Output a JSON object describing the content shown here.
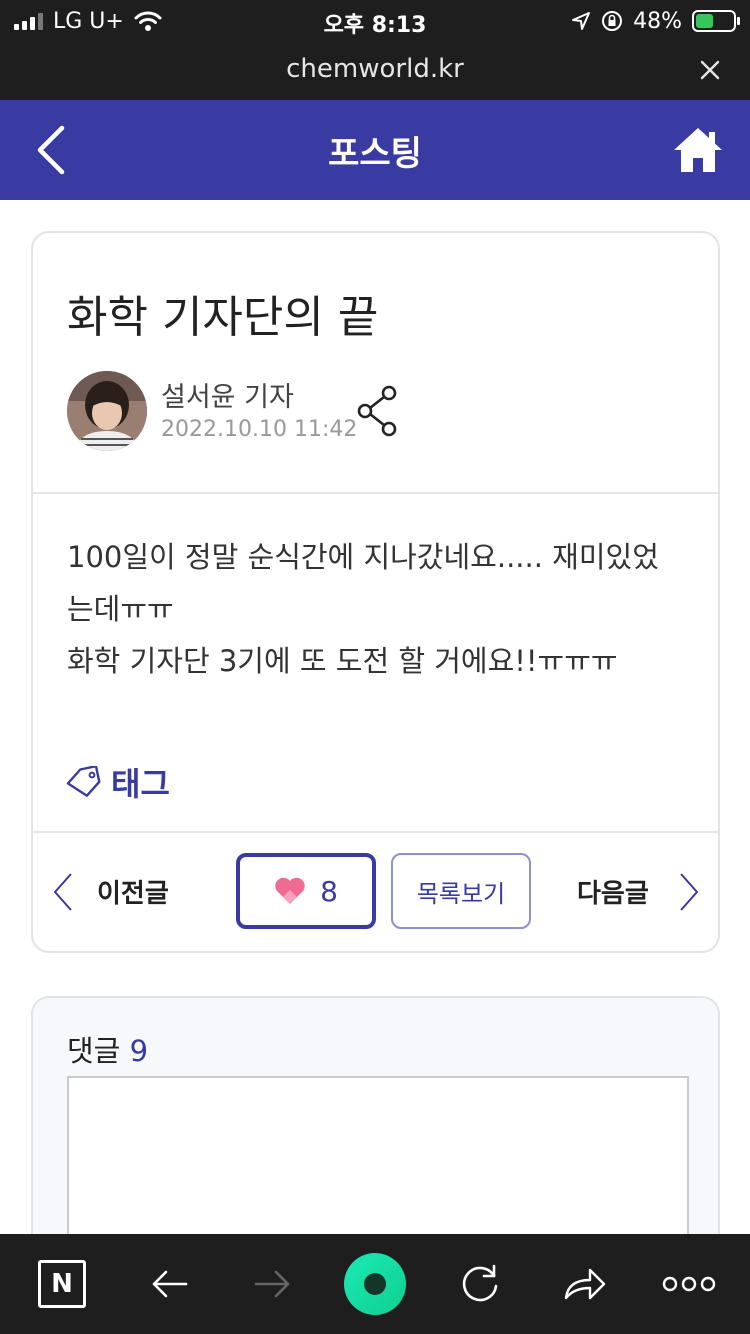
{
  "status_bar": {
    "carrier": "LG U+",
    "time": "오후 8:13",
    "battery_percent": "48%",
    "battery_level": 0.48
  },
  "url_bar": {
    "domain": "chemworld.kr"
  },
  "header": {
    "title": "포스팅",
    "accent_color": "#3a3ba2"
  },
  "post": {
    "title": "화학 기자단의 끝",
    "author": "설서윤 기자",
    "date": "2022.10.10 11:42",
    "body_lines": [
      "100일이 정말 순식간에 지나갔네요..... 재미있었",
      "는데ㅠㅠ",
      "화학 기자단 3기에 또 도전 할 거에요!!ㅠㅠㅠ"
    ],
    "tag_label": "태그"
  },
  "nav": {
    "prev_label": "이전글",
    "like_count": "8",
    "list_label": "목록보기",
    "next_label": "다음글"
  },
  "comments": {
    "label": "댓글",
    "count": "9"
  },
  "toolbar": {
    "n_label": "N",
    "icons": [
      "n-icon",
      "back-icon",
      "forward-icon",
      "green-home-icon",
      "refresh-icon",
      "share-icon",
      "more-icon"
    ]
  }
}
